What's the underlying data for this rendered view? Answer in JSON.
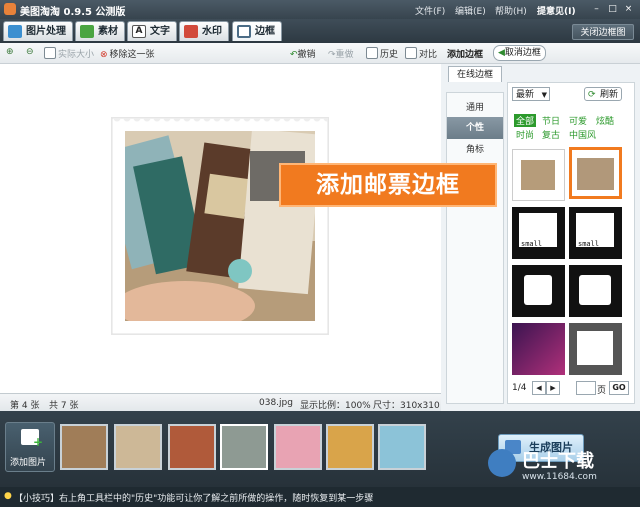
{
  "title": "美图淘淘 0.9.5 公测版",
  "menu": [
    "文件(F)",
    "编辑(E)",
    "帮助(H)",
    "提意见(I)"
  ],
  "tabs": [
    {
      "label": "图片处理",
      "icon": "image-icon"
    },
    {
      "label": "素材",
      "icon": "material-icon"
    },
    {
      "label": "文字",
      "icon": "text-icon"
    },
    {
      "label": "水印",
      "icon": "watermark-icon"
    },
    {
      "label": "边框",
      "icon": "frame-icon"
    }
  ],
  "close_frame_label": "关闭边框图",
  "tools": {
    "actual_size": "实际大小",
    "remove_one": "移除这一张",
    "undo": "撤销",
    "redo": "重做",
    "history": "历史",
    "compare": "对比"
  },
  "status": {
    "current": "第 4 张",
    "total": "共 7 张",
    "filename": "038.jpg",
    "zoom": "显示比例：100%",
    "size": "尺寸：310x310"
  },
  "right": {
    "add_frame": "添加边框",
    "cancel_frame": "取消边框",
    "online_tab": "在线边框",
    "categories": [
      "通用",
      "个性",
      "角标"
    ],
    "selected_category": "个性",
    "sort": "最新",
    "refresh": "刷新",
    "filters_row1": [
      "全部",
      "节日",
      "可爱",
      "炫酷"
    ],
    "filters_row2": [
      "时尚",
      "复古",
      "中国风"
    ],
    "thumb_text": "small",
    "page": "1/4",
    "page_suffix": "页",
    "go": "GO"
  },
  "callout": "添加邮票边框",
  "add_picture": "添加图片",
  "generate": "生成图片",
  "tip": "【小技巧】右上角工具栏中的\"历史\"功能可让你了解之前所做的操作，随时恢复到某一步骤",
  "watermark": {
    "name": "巴士下载",
    "url": "www.11684.com"
  },
  "colors": {
    "accent": "#f17a1f",
    "filter_active": "#2c9a2c",
    "dark": "#2e3a44"
  }
}
